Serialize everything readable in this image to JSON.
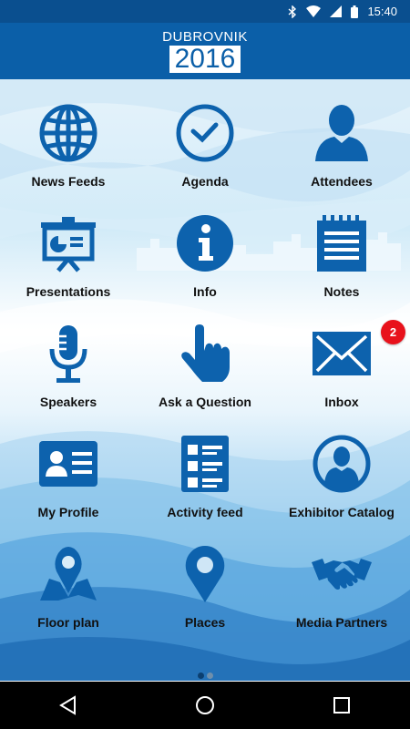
{
  "status_bar": {
    "time": "15:40",
    "icons": [
      "bluetooth-icon",
      "wifi-icon",
      "signal-icon",
      "battery-icon"
    ]
  },
  "header": {
    "city": "DUBROVNIK",
    "year": "2016"
  },
  "menu": [
    {
      "label": "News Feeds",
      "icon": "globe-icon"
    },
    {
      "label": "Agenda",
      "icon": "clock-icon"
    },
    {
      "label": "Attendees",
      "icon": "person-icon"
    },
    {
      "label": "Presentations",
      "icon": "presentation-board-icon"
    },
    {
      "label": "Info",
      "icon": "info-icon"
    },
    {
      "label": "Notes",
      "icon": "notepad-icon"
    },
    {
      "label": "Speakers",
      "icon": "microphone-icon"
    },
    {
      "label": "Ask a Question",
      "icon": "pointing-hand-icon"
    },
    {
      "label": "Inbox",
      "icon": "envelope-icon"
    },
    {
      "label": "My Profile",
      "icon": "id-card-icon"
    },
    {
      "label": "Activity feed",
      "icon": "activity-list-icon"
    },
    {
      "label": "Exhibitor Catalog",
      "icon": "person-circle-icon"
    },
    {
      "label": "Floor plan",
      "icon": "map-pin-icon"
    },
    {
      "label": "Places",
      "icon": "location-pin-icon"
    },
    {
      "label": "Media Partners",
      "icon": "handshake-icon"
    }
  ],
  "inbox_badge": "2",
  "pager": {
    "pages": 2,
    "current": 1
  },
  "colors": {
    "brand_blue": "#0b5fa8",
    "status_bar": "#0a4f8f",
    "icon_blue": "#0d62ad",
    "badge_red": "#e8121c"
  }
}
